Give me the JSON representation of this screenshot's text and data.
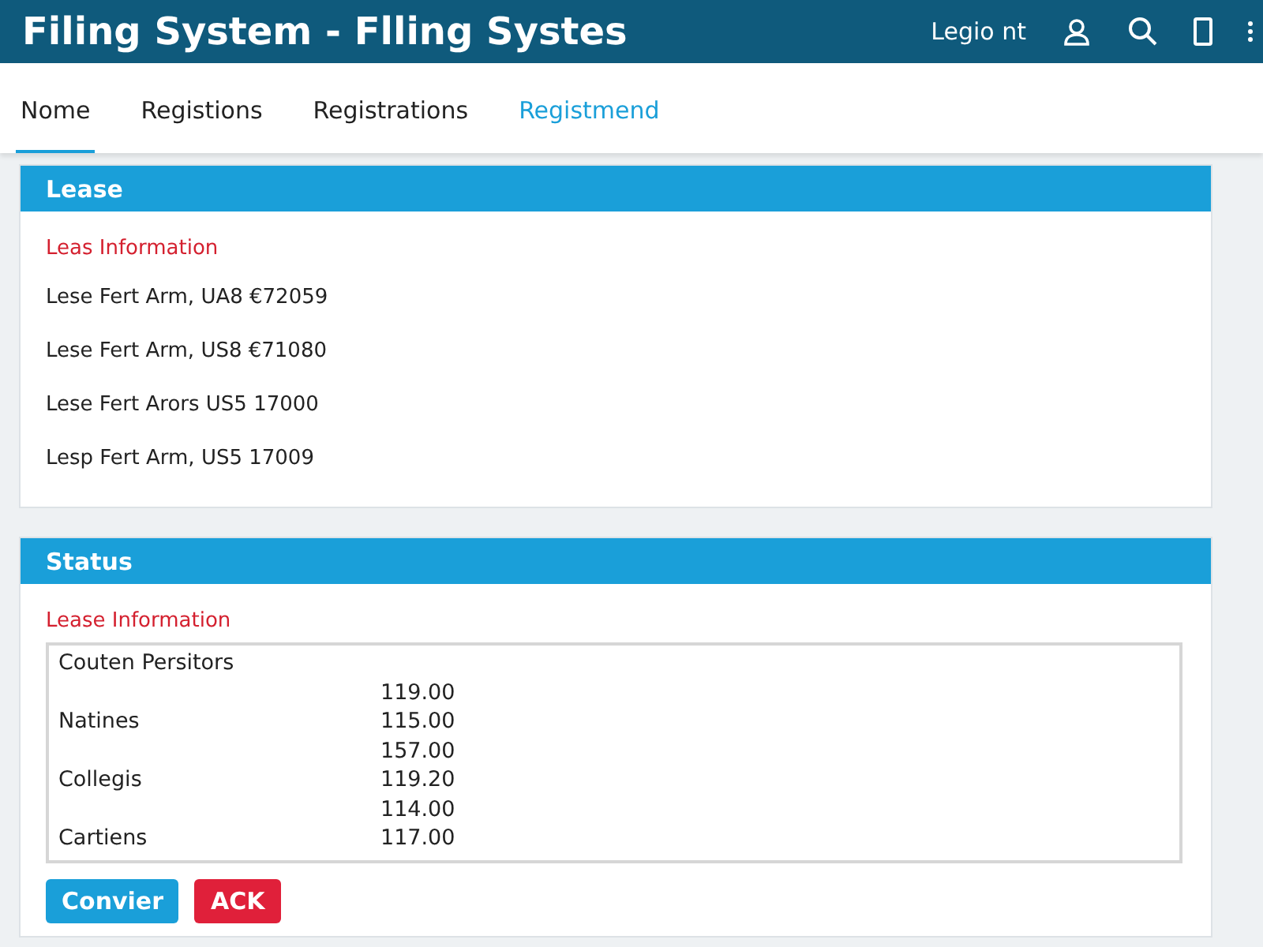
{
  "window": {
    "title": "Filing System - Flling Systes"
  },
  "header": {
    "user_label": "Legio nt"
  },
  "tabs": [
    {
      "label": "Nome",
      "selected": true,
      "accent": false
    },
    {
      "label": "Registions",
      "selected": false,
      "accent": false
    },
    {
      "label": "Registrations",
      "selected": false,
      "accent": false
    },
    {
      "label": "Registmend",
      "selected": false,
      "accent": true
    }
  ],
  "lease": {
    "title": "Lease",
    "subtitle": "Leas Information",
    "rows": [
      "Lese Fert Arm, UA8 €72059",
      "Lese Fert Arm, US8 €71080",
      "Lese Fert Arors US5 17000",
      "Lesp Fert Arm, US5 17009"
    ]
  },
  "status": {
    "title": "Status",
    "subtitle": "Lease Information",
    "lines": [
      {
        "label": "Couten Persitors"
      },
      {
        "value": "119.00"
      },
      {
        "label": "Natines",
        "value": "115.00"
      },
      {
        "value": "157.00"
      },
      {
        "label": "Collegis",
        "value": "119.20"
      },
      {
        "value": "114.00"
      },
      {
        "label": "Cartiens",
        "value": "117.00"
      }
    ]
  },
  "buttons": [
    {
      "label": "Convier",
      "kind": "primary"
    },
    {
      "label": "ACK",
      "kind": "danger"
    }
  ]
}
